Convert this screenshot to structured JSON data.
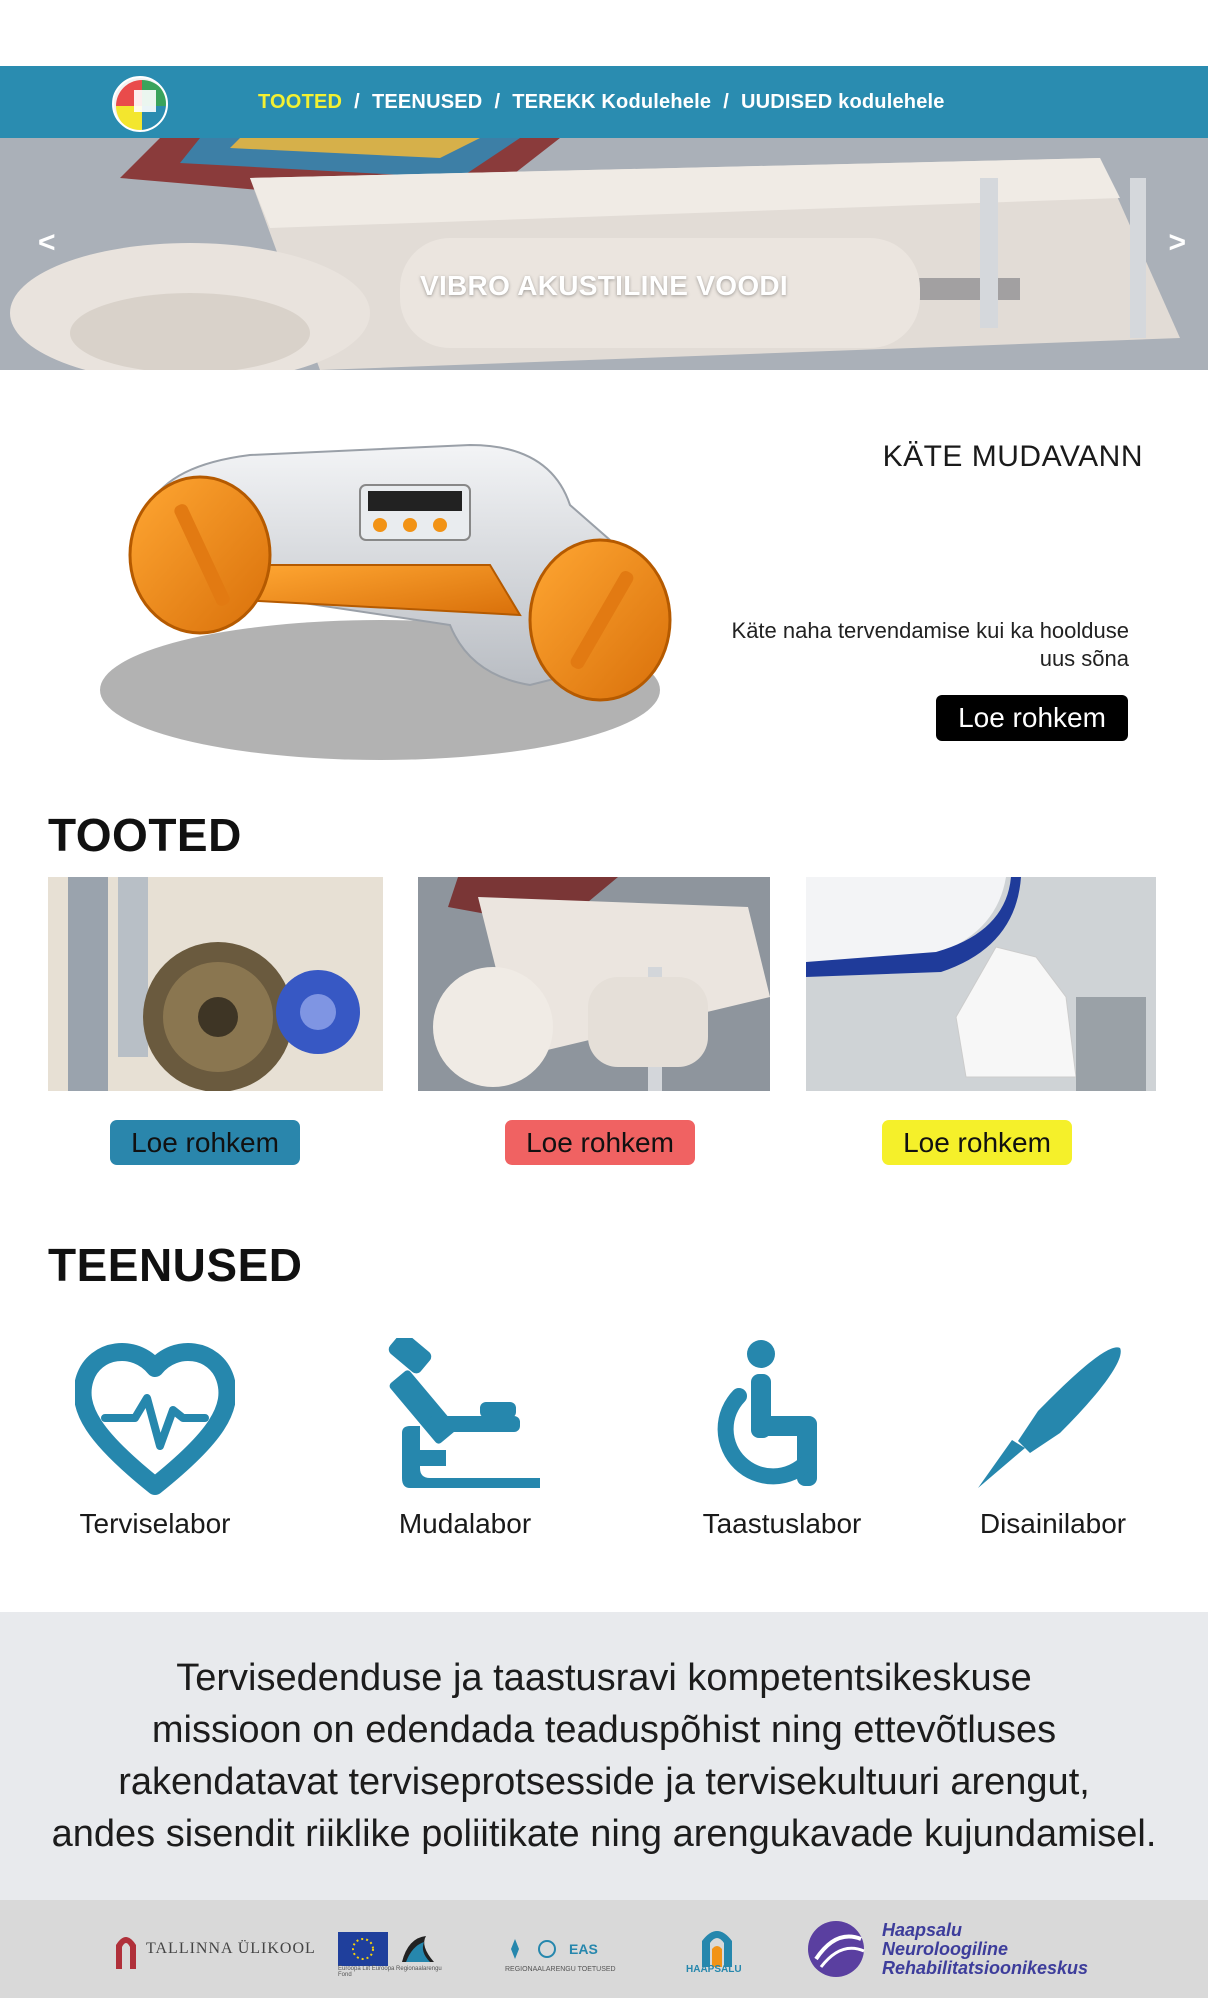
{
  "nav": {
    "items": [
      {
        "label": "TOOTED",
        "active": true
      },
      {
        "label": "TEENUSED"
      },
      {
        "label": "TEREKK Kodulehele"
      },
      {
        "label": "UUDISED kodulehele"
      }
    ],
    "separator": "/"
  },
  "hero": {
    "title": "VIBRO AKUSTILINE VOODI",
    "prev": "<",
    "next": ">"
  },
  "feature": {
    "title": "KÄTE MUDAVANN",
    "description": "Käte naha tervendamise kui ka hoolduse uus sõna",
    "button": "Loe rohkem"
  },
  "products": {
    "heading": "TOOTED",
    "cards": [
      {
        "button": "Loe rohkem",
        "color": "#2a86ac"
      },
      {
        "button": "Loe rohkem",
        "color": "#f06262"
      },
      {
        "button": "Loe rohkem",
        "color": "#f5f02a"
      }
    ]
  },
  "services": {
    "heading": "TEENUSED",
    "items": [
      {
        "label": "Terviselabor",
        "icon": "heart-pulse-icon"
      },
      {
        "label": "Mudalabor",
        "icon": "microscope-icon"
      },
      {
        "label": "Taastuslabor",
        "icon": "wheelchair-icon"
      },
      {
        "label": "Disainilabor",
        "icon": "pen-icon"
      }
    ],
    "icon_color": "#2687ad"
  },
  "mission": {
    "lines": [
      "Tervisedenduse ja taastusravi kompetentsikeskuse",
      "missioon on edendada teaduspõhist ning ettevõtluses",
      "rakendatavat terviseprotsesside ja tervisekultuuri arengut,",
      "andes sisendit riiklike poliitikate ning arengukavade kujundamisel."
    ]
  },
  "footer": {
    "logos": [
      {
        "name": "Tallinna Ülikool",
        "text": "TALLINNA ÜLIKOOL"
      },
      {
        "name": "EU regional fund",
        "text": "Euroopa Liit Euroopa Regionaalarengu Fond"
      },
      {
        "name": "EAS",
        "text": "EAS",
        "sub": "REGIONAALARENGU TOETUSED"
      },
      {
        "name": "Haapsalu",
        "text": "HAAPSALU"
      },
      {
        "name": "Haapsalu Neuroloogiline Rehabilitatsioonikeskus",
        "line1": "Haapsalu",
        "line2": "Neuroloogiline",
        "line3": "Rehabilitatsioonikeskus"
      }
    ]
  }
}
